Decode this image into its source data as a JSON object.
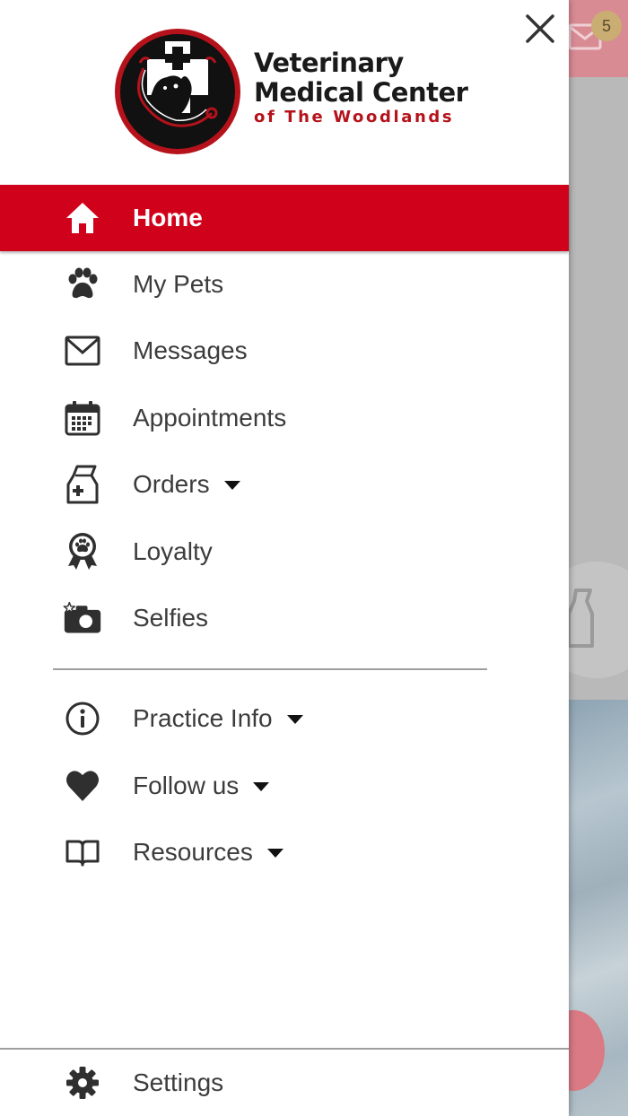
{
  "background": {
    "message_badge": "5"
  },
  "logo": {
    "line1": "Veterinary",
    "line2": "Medical Center",
    "line3": "of The Woodlands"
  },
  "menu": {
    "primary": [
      {
        "label": "Home",
        "icon": "home-icon",
        "active": true
      },
      {
        "label": "My Pets",
        "icon": "paw-icon"
      },
      {
        "label": "Messages",
        "icon": "envelope-icon"
      },
      {
        "label": "Appointments",
        "icon": "calendar-icon"
      },
      {
        "label": "Orders",
        "icon": "food-bag-icon",
        "has_dropdown": true
      },
      {
        "label": "Loyalty",
        "icon": "award-ribbon-icon"
      },
      {
        "label": "Selfies",
        "icon": "camera-icon"
      }
    ],
    "secondary": [
      {
        "label": "Practice Info",
        "icon": "info-icon",
        "has_dropdown": true
      },
      {
        "label": "Follow us",
        "icon": "heart-icon",
        "has_dropdown": true
      },
      {
        "label": "Resources",
        "icon": "book-icon",
        "has_dropdown": true
      }
    ],
    "footer": [
      {
        "label": "Settings",
        "icon": "gear-icon"
      }
    ]
  },
  "colors": {
    "accent": "#d0021b",
    "text": "#3c3c3c",
    "icon": "#2f2f2f"
  }
}
